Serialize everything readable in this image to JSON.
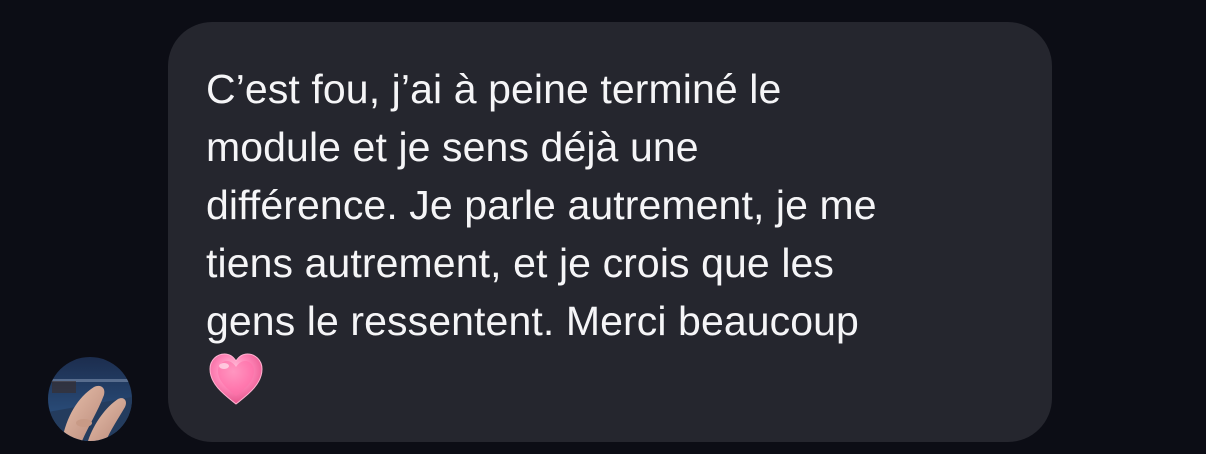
{
  "message": {
    "text": "C’est fou, j’ai à peine terminé le\nmodule et je sens déjà une\ndifférence. Je parle autrement, je me\ntiens autrement, et je crois que les\ngens le ressentent. Merci beaucoup",
    "emoji_icon": "growing-heart-emoji",
    "bubble_color": "#25262e",
    "text_color": "#f5f5f7"
  },
  "sender": {
    "avatar_icon": "contact-avatar"
  },
  "background_color": "#0c0d15"
}
